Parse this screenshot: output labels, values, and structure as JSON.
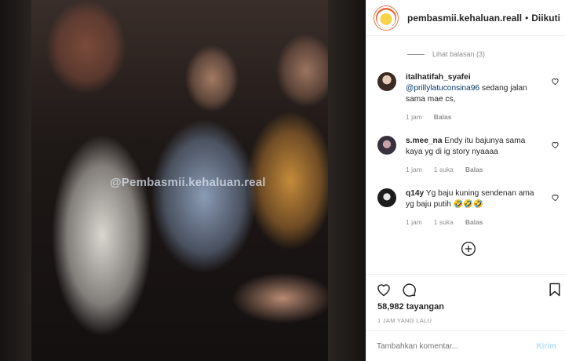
{
  "media": {
    "watermark": "@Pembasmii.kehaluan.real"
  },
  "header": {
    "username": "pembasmii.kehaluan.reall",
    "separator": "•",
    "follow_status": "Diikuti"
  },
  "view_replies": "Lihat balasan (3)",
  "comments": [
    {
      "username": "italhatifah_syafei",
      "mention": "@prillylatuconsina96",
      "text": " sedang jalan sama mae cs,",
      "time": "1 jam",
      "likes": "",
      "reply": "Balas"
    },
    {
      "username": "s.mee_na",
      "mention": "",
      "text": " Endy itu bajunya sama kaya yg di ig story nyaaaa",
      "time": "1 jam",
      "likes": "1 suka",
      "reply": "Balas"
    },
    {
      "username": "q14y",
      "mention": "",
      "text": " Yg baju kuning sendenan ama yg baju putih 🤣🤣🤣",
      "time": "1 jam",
      "likes": "1 suka",
      "reply": "Balas"
    }
  ],
  "stats": {
    "views": "58,982 tayangan",
    "time_ago": "1 JAM YANG LALU"
  },
  "add_comment": {
    "placeholder": "Tambahkan komentar...",
    "post_label": "Kirim"
  },
  "icons": {
    "header_avatar": "profile-avatar",
    "like": "heart-icon",
    "comment": "comment-icon",
    "save": "bookmark-icon",
    "load_more": "plus-circle-icon"
  },
  "colors": {
    "link": "#00376b",
    "muted": "#8e8e8e",
    "post_disabled": "#b2dffc"
  }
}
